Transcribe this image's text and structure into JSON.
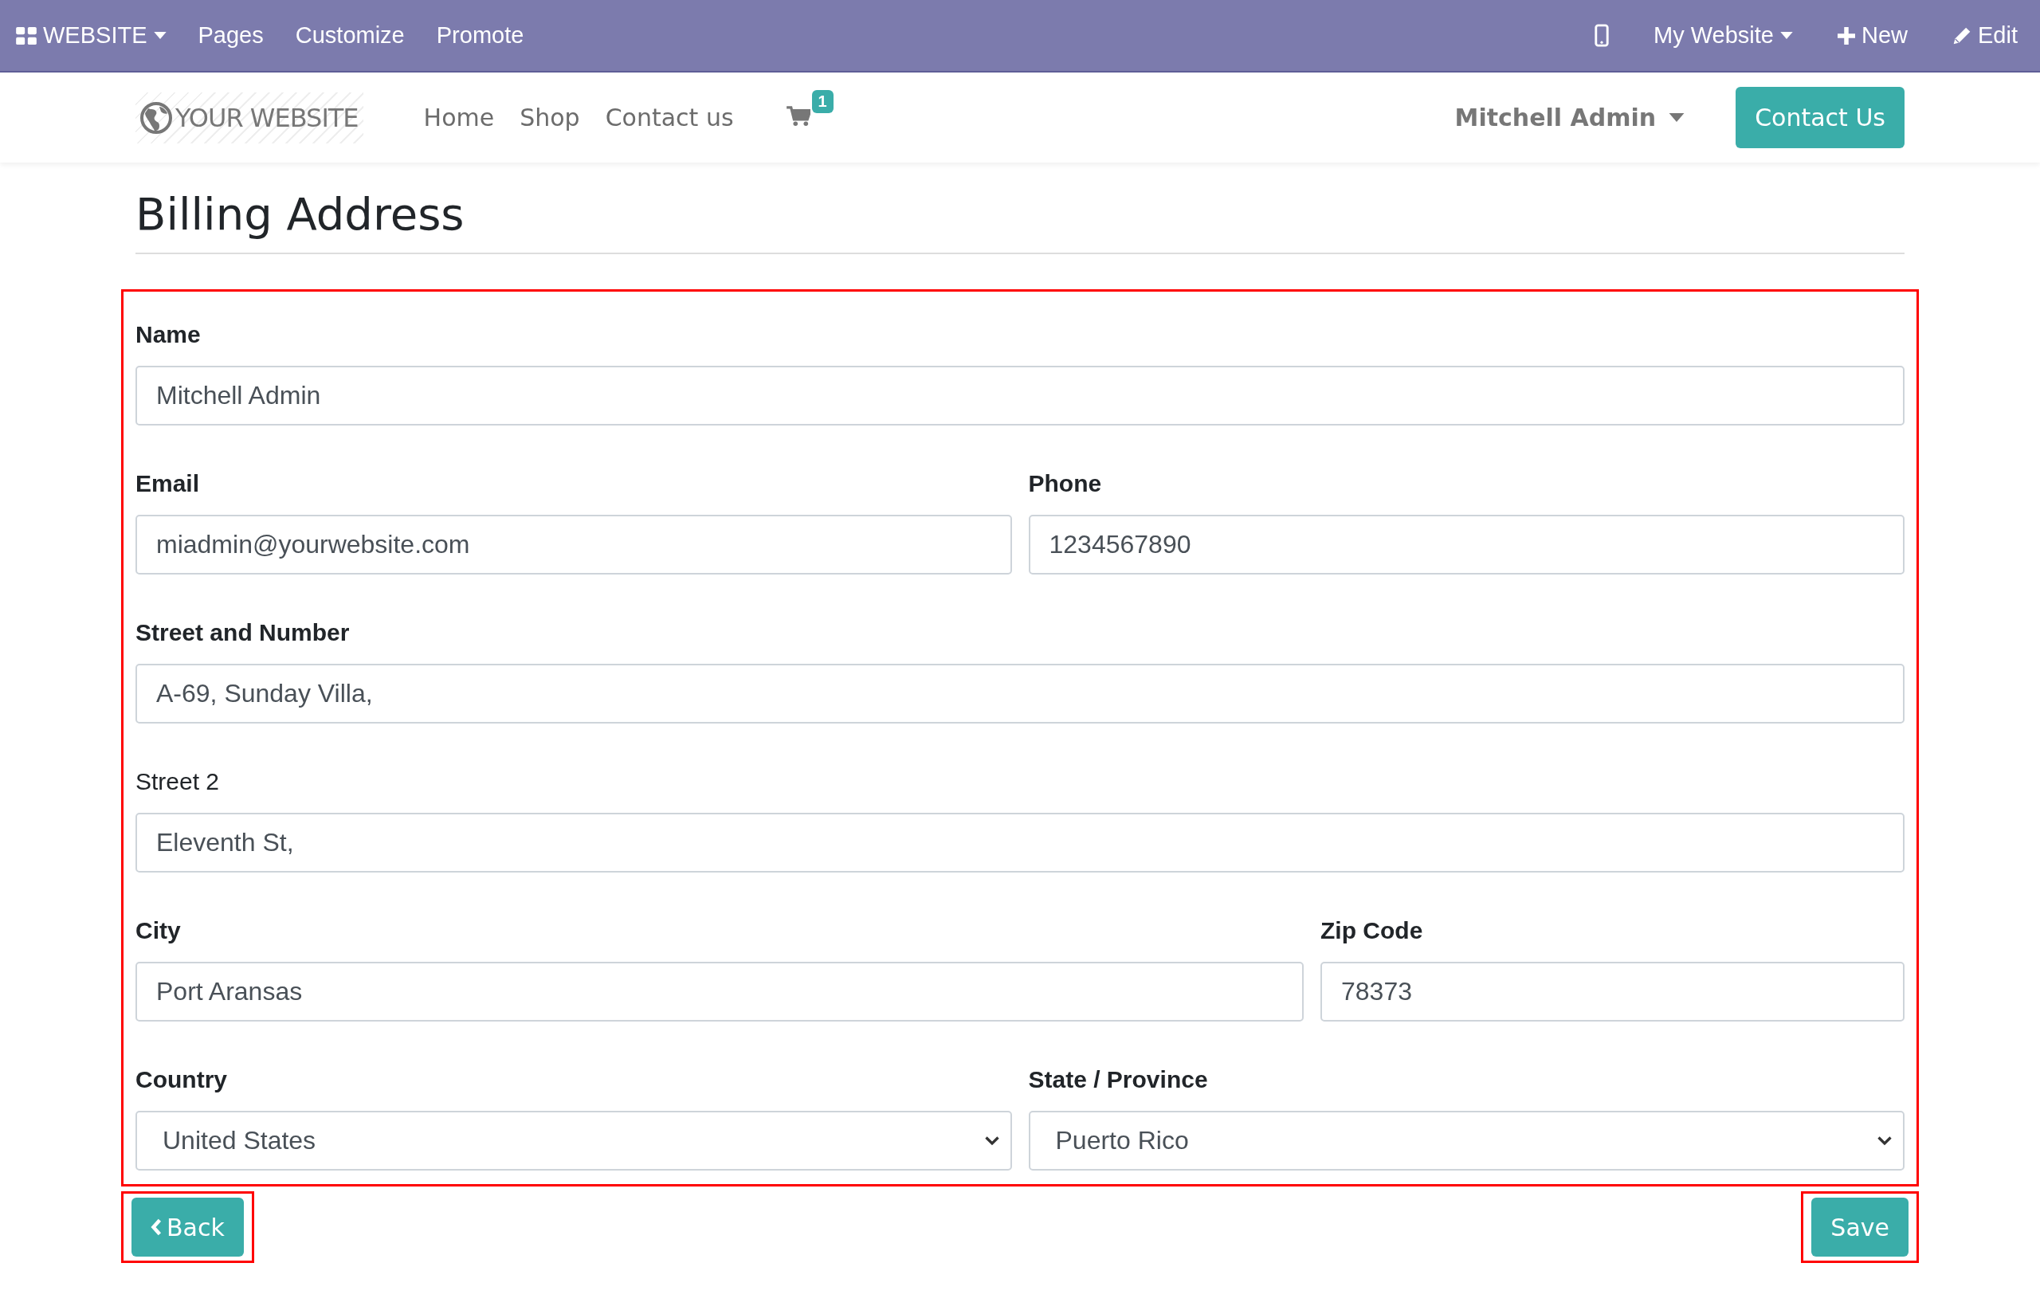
{
  "admin_bar": {
    "app_menu": "WEBSITE",
    "menu_items": [
      "Pages",
      "Customize",
      "Promote"
    ],
    "website_switcher": "My Website",
    "new_label": "New",
    "edit_label": "Edit"
  },
  "site_nav": {
    "logo_text": "YOUR WEBSITE",
    "links": [
      "Home",
      "Shop",
      "Contact us"
    ],
    "cart_count": "1",
    "user_menu": "Mitchell Admin",
    "cta": "Contact Us"
  },
  "page_title": "Billing Address",
  "form": {
    "highlighted": true,
    "rows": [
      {
        "fields": [
          {
            "label": "Name",
            "required": true,
            "kind": "text",
            "value": "Mitchell Admin"
          }
        ]
      },
      {
        "fields": [
          {
            "label": "Email",
            "required": true,
            "kind": "text",
            "value": "miadmin@yourwebsite.com"
          },
          {
            "label": "Phone",
            "required": true,
            "kind": "text",
            "value": "1234567890"
          }
        ]
      },
      {
        "fields": [
          {
            "label": "Street and Number",
            "required": true,
            "kind": "text",
            "value": "A-69, Sunday Villa,"
          }
        ]
      },
      {
        "fields": [
          {
            "label": "Street 2",
            "required": false,
            "kind": "text",
            "value": "Eleventh St,"
          }
        ]
      },
      {
        "fields": [
          {
            "label": "City",
            "required": true,
            "kind": "text",
            "value": "Port Aransas"
          },
          {
            "label": "Zip Code",
            "required": true,
            "kind": "text",
            "value": "78373"
          }
        ]
      },
      {
        "fields": [
          {
            "label": "Country",
            "required": true,
            "kind": "select",
            "value": "United States"
          },
          {
            "label": "State / Province",
            "required": true,
            "kind": "select",
            "value": "Puerto Rico"
          }
        ]
      }
    ]
  },
  "actions": [
    {
      "kind": "back",
      "label": "Back",
      "highlighted": true
    },
    {
      "kind": "save",
      "label": "Save",
      "highlighted": true
    }
  ]
}
